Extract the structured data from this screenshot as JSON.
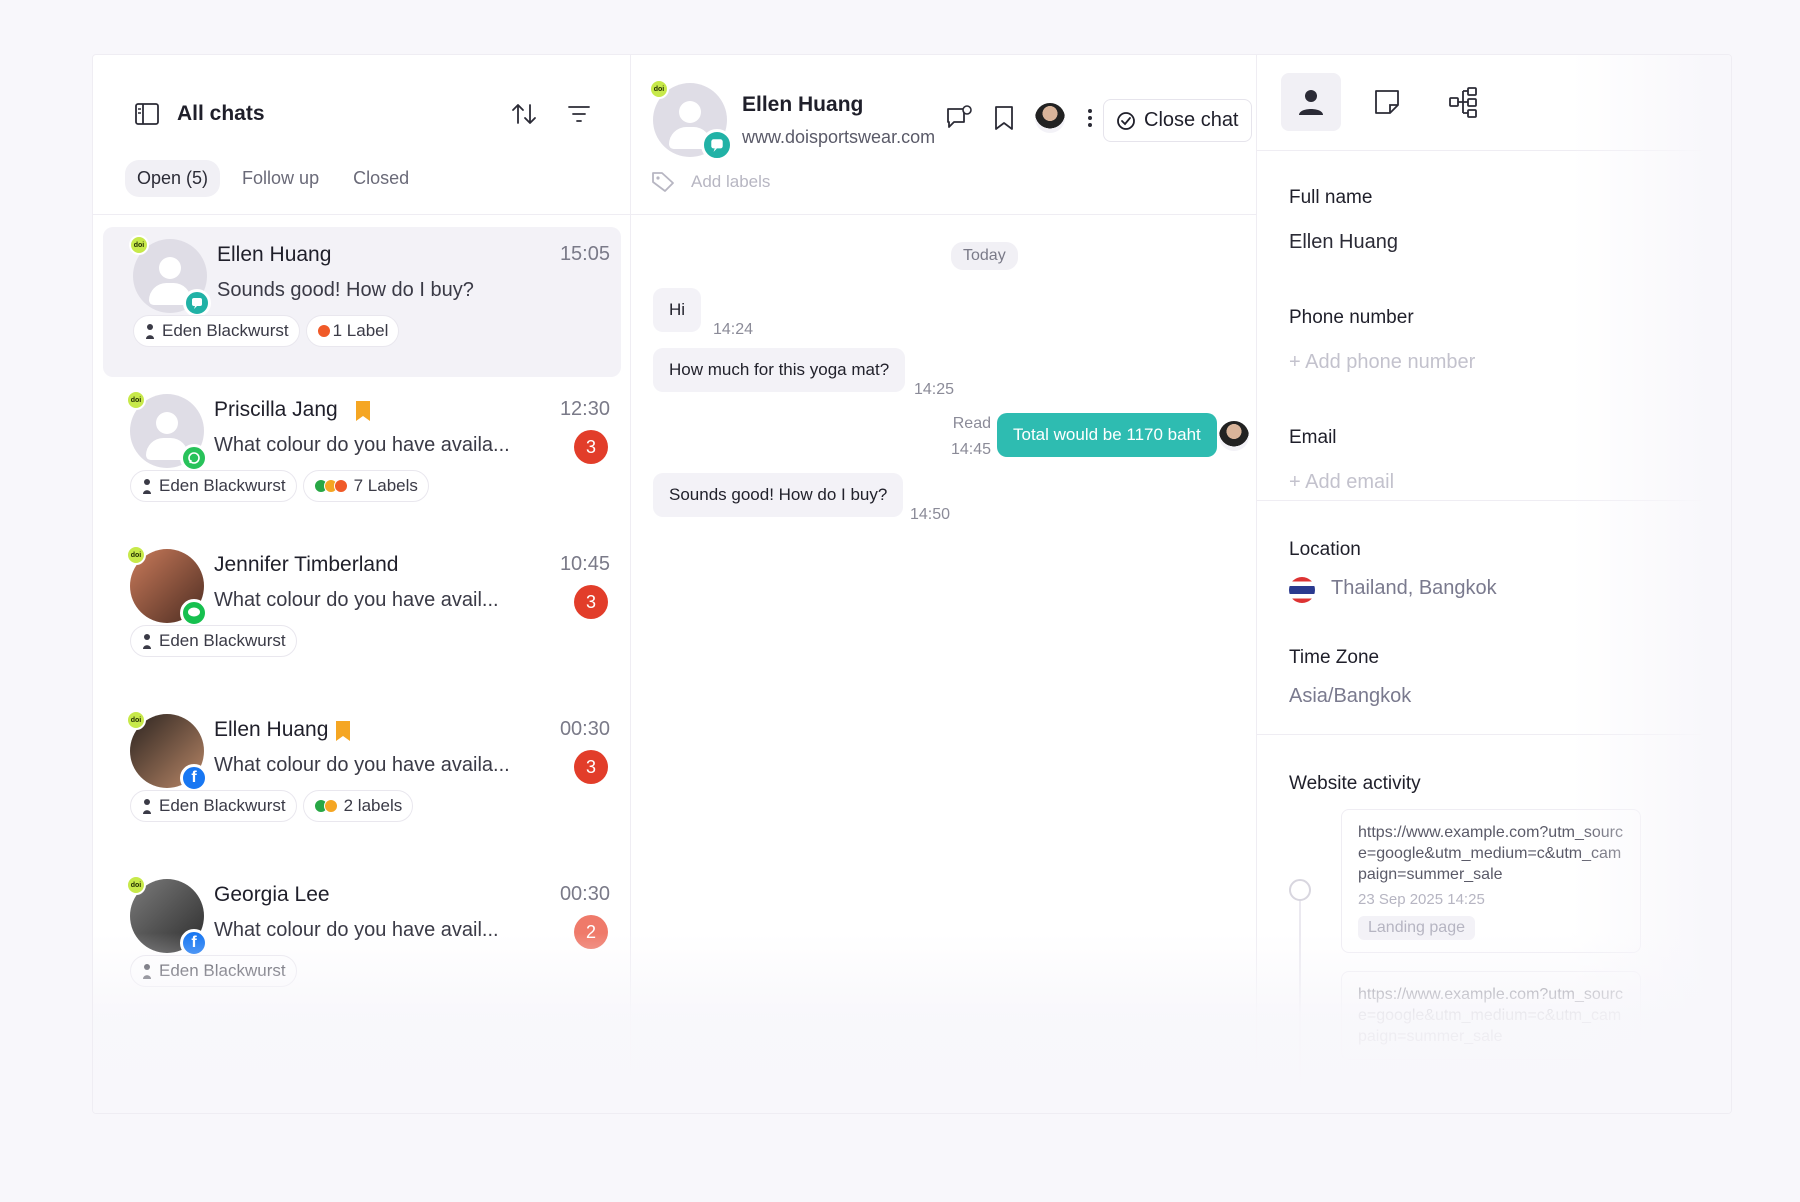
{
  "chat_list": {
    "title": "All chats",
    "tabs": [
      {
        "label": "Open (5)"
      },
      {
        "label": "Follow up"
      },
      {
        "label": "Closed"
      }
    ],
    "items": [
      {
        "brand": "doi",
        "name": "Ellen Huang",
        "time": "15:05",
        "preview": "Sounds good! How do I buy?",
        "assignee": "Eden Blackwurst",
        "labels": "1 Label",
        "unread": ""
      },
      {
        "brand": "doi",
        "name": "Priscilla Jang",
        "time": "12:30",
        "preview": "What colour do you have availa...",
        "assignee": "Eden Blackwurst",
        "labels": "7 Labels",
        "unread": "3"
      },
      {
        "brand": "doi",
        "name": "Jennifer Timberland",
        "time": "10:45",
        "preview": "What colour do you have avail...",
        "assignee": "Eden Blackwurst",
        "labels": "",
        "unread": "3"
      },
      {
        "brand": "doi",
        "name": "Ellen Huang",
        "time": "00:30",
        "preview": "What colour do you have availa...",
        "assignee": "Eden Blackwurst",
        "labels": "2 labels",
        "unread": "3"
      },
      {
        "brand": "doi",
        "name": "Georgia Lee",
        "time": "00:30",
        "preview": "What colour do you have avail...",
        "assignee": "Eden Blackwurst",
        "labels": "",
        "unread": "2"
      }
    ]
  },
  "conversation": {
    "brand": "doi",
    "name": "Ellen Huang",
    "site": "www.doisportswear.com",
    "close_label": "Close chat",
    "add_labels": "Add labels",
    "day": "Today",
    "messages": [
      {
        "text": "Hi",
        "time": "14:24"
      },
      {
        "text": "How much for this yoga mat?",
        "time": "14:25"
      },
      {
        "text": "Total would be 1170 baht",
        "time": "14:45",
        "status": "Read"
      },
      {
        "text": "Sounds good! How do I buy?",
        "time": "14:50"
      }
    ]
  },
  "contact": {
    "full_name_label": "Full name",
    "full_name": "Ellen Huang",
    "phone_label": "Phone number",
    "phone_add": "+ Add phone number",
    "email_label": "Email",
    "email_add": "+ Add email",
    "location_label": "Location",
    "location": "Thailand, Bangkok",
    "timezone_label": "Time Zone",
    "timezone": "Asia/Bangkok",
    "activity_label": "Website activity",
    "activity": [
      {
        "url": "https://www.example.com?utm_source=google&utm_medium=c&utm_campaign=summer_sale",
        "date": "23 Sep 2025 14:25",
        "tag": "Landing page"
      },
      {
        "url": "https://www.example.com?utm_source=google&utm_medium=c&utm_campaign=summer_sale",
        "date": "",
        "tag": ""
      }
    ]
  },
  "colors": {
    "accent": "#2ebcb1",
    "unread": "#e23d2a",
    "bookmark": "#f5a623"
  }
}
